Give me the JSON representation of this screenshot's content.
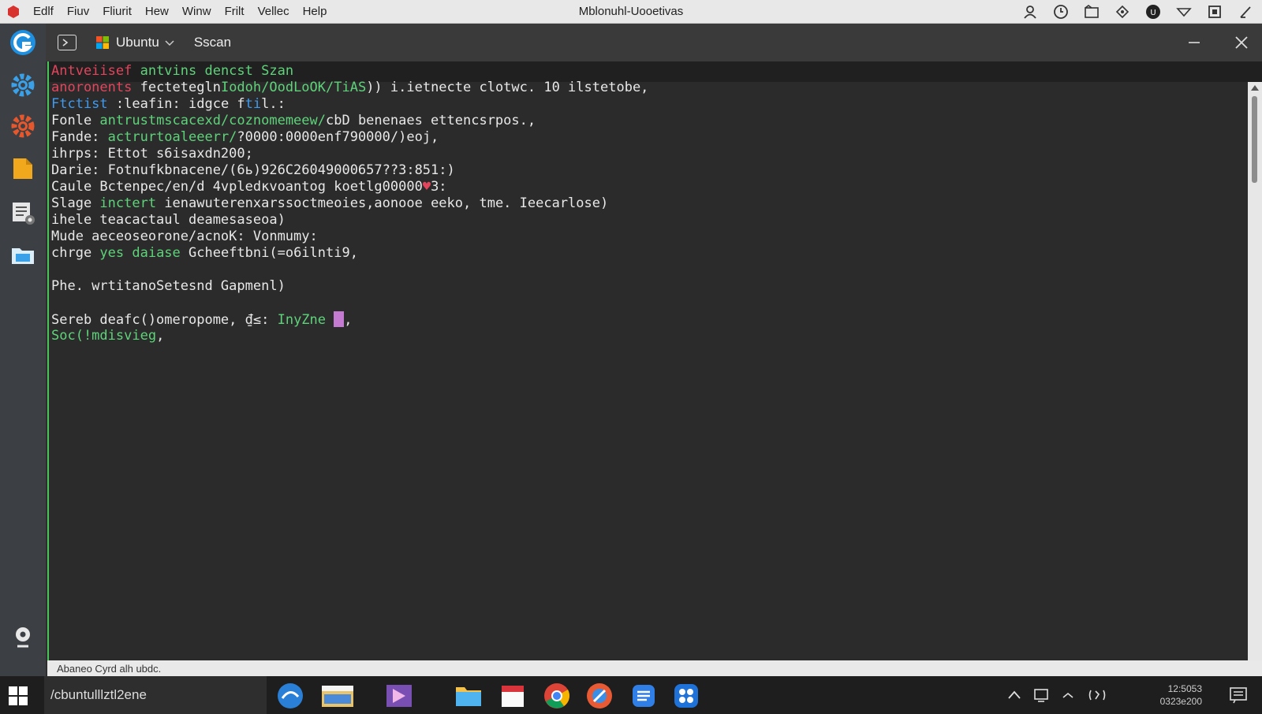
{
  "menubar": {
    "items": [
      "Edlf",
      "Fiuv",
      "Fliurit",
      "Hew",
      "Winw",
      "Frilt",
      "Vellec",
      "Help"
    ],
    "title": "Mblonuhl-Uooetivas"
  },
  "terminal": {
    "tab_label": "Ubuntu",
    "tab_title": "Sscan",
    "lines": [
      [
        {
          "t": "Antveiisef ",
          "c": "red"
        },
        {
          "t": "antvins dencst Szan",
          "c": "green"
        }
      ],
      [
        {
          "t": "anoronents ",
          "c": "red"
        },
        {
          "t": "fectetegln",
          "c": "white"
        },
        {
          "t": "Iodoh/OodLoOK/TiAS",
          "c": "green"
        },
        {
          "t": ")) i.ietnecte clotwc. 10 ilstetobe,",
          "c": "white"
        }
      ],
      [
        {
          "t": "Ftctist ",
          "c": "blue"
        },
        {
          "t": ":leafin: idgce f",
          "c": "white"
        },
        {
          "t": "ti",
          "c": "blue"
        },
        {
          "t": "l.:",
          "c": "white"
        }
      ],
      [
        {
          "t": "Fonle ",
          "c": "white"
        },
        {
          "t": "antrustmscacexd/coznomemeew/",
          "c": "green"
        },
        {
          "t": "cbD benenaes ettencsrpos.,",
          "c": "white"
        }
      ],
      [
        {
          "t": "Fande: ",
          "c": "white"
        },
        {
          "t": "actrurtoaleeerr/",
          "c": "green"
        },
        {
          "t": "?0000:0000enf790000/)eoj,",
          "c": "white"
        }
      ],
      [
        {
          "t": "ihrps: Ettot s6isaxdn200;",
          "c": "white"
        }
      ],
      [
        {
          "t": "Darie: Fotnufkbnacene/(6ь)926C26049000657??3:851:)",
          "c": "white"
        }
      ],
      [
        {
          "t": "Caule Bctenpec/en/d 4vpledкvoantog koetlg00000",
          "c": "white"
        },
        {
          "t": "♥",
          "c": "red"
        },
        {
          "t": "3:",
          "c": "white"
        }
      ],
      [
        {
          "t": "Slage ",
          "c": "white"
        },
        {
          "t": "inctert",
          "c": "green"
        },
        {
          "t": " ienawuterenxarssoctmeoies,aonooe eeko, tme. Ieecarlose)",
          "c": "white"
        }
      ],
      [
        {
          "t": "ihele teacactaul deamesaseoa)",
          "c": "white"
        }
      ],
      [
        {
          "t": "Mude aeceoseorone/acnoK: Vonmumy:",
          "c": "white"
        }
      ],
      [
        {
          "t": "chrge ",
          "c": "white"
        },
        {
          "t": "yes daiase ",
          "c": "green"
        },
        {
          "t": "Gcheeftbni(=o6ilnti9,",
          "c": "white"
        }
      ],
      [],
      [
        {
          "t": "Phe. wrtitanoSetesnd Gapmenl)",
          "c": "white"
        }
      ],
      [],
      [
        {
          "t": "Sereb deafc()omeropome, ",
          "c": "white"
        },
        {
          "t": "₫≤: ",
          "c": "white"
        },
        {
          "t": "InyZne ",
          "c": "green"
        },
        {
          "t": "[CURSOR]",
          "c": "cursor"
        },
        {
          "t": ",",
          "c": "white"
        }
      ],
      [
        {
          "t": "Soc(!mdisvieg",
          "c": "green"
        },
        {
          "t": ",",
          "c": "white"
        }
      ]
    ],
    "status_text": "Abaneo Cyrd alh ubdc."
  },
  "taskbar": {
    "search_text": "/cbuntulllztl2ene",
    "clock_time": "12:5053",
    "clock_date": "0323e200"
  }
}
